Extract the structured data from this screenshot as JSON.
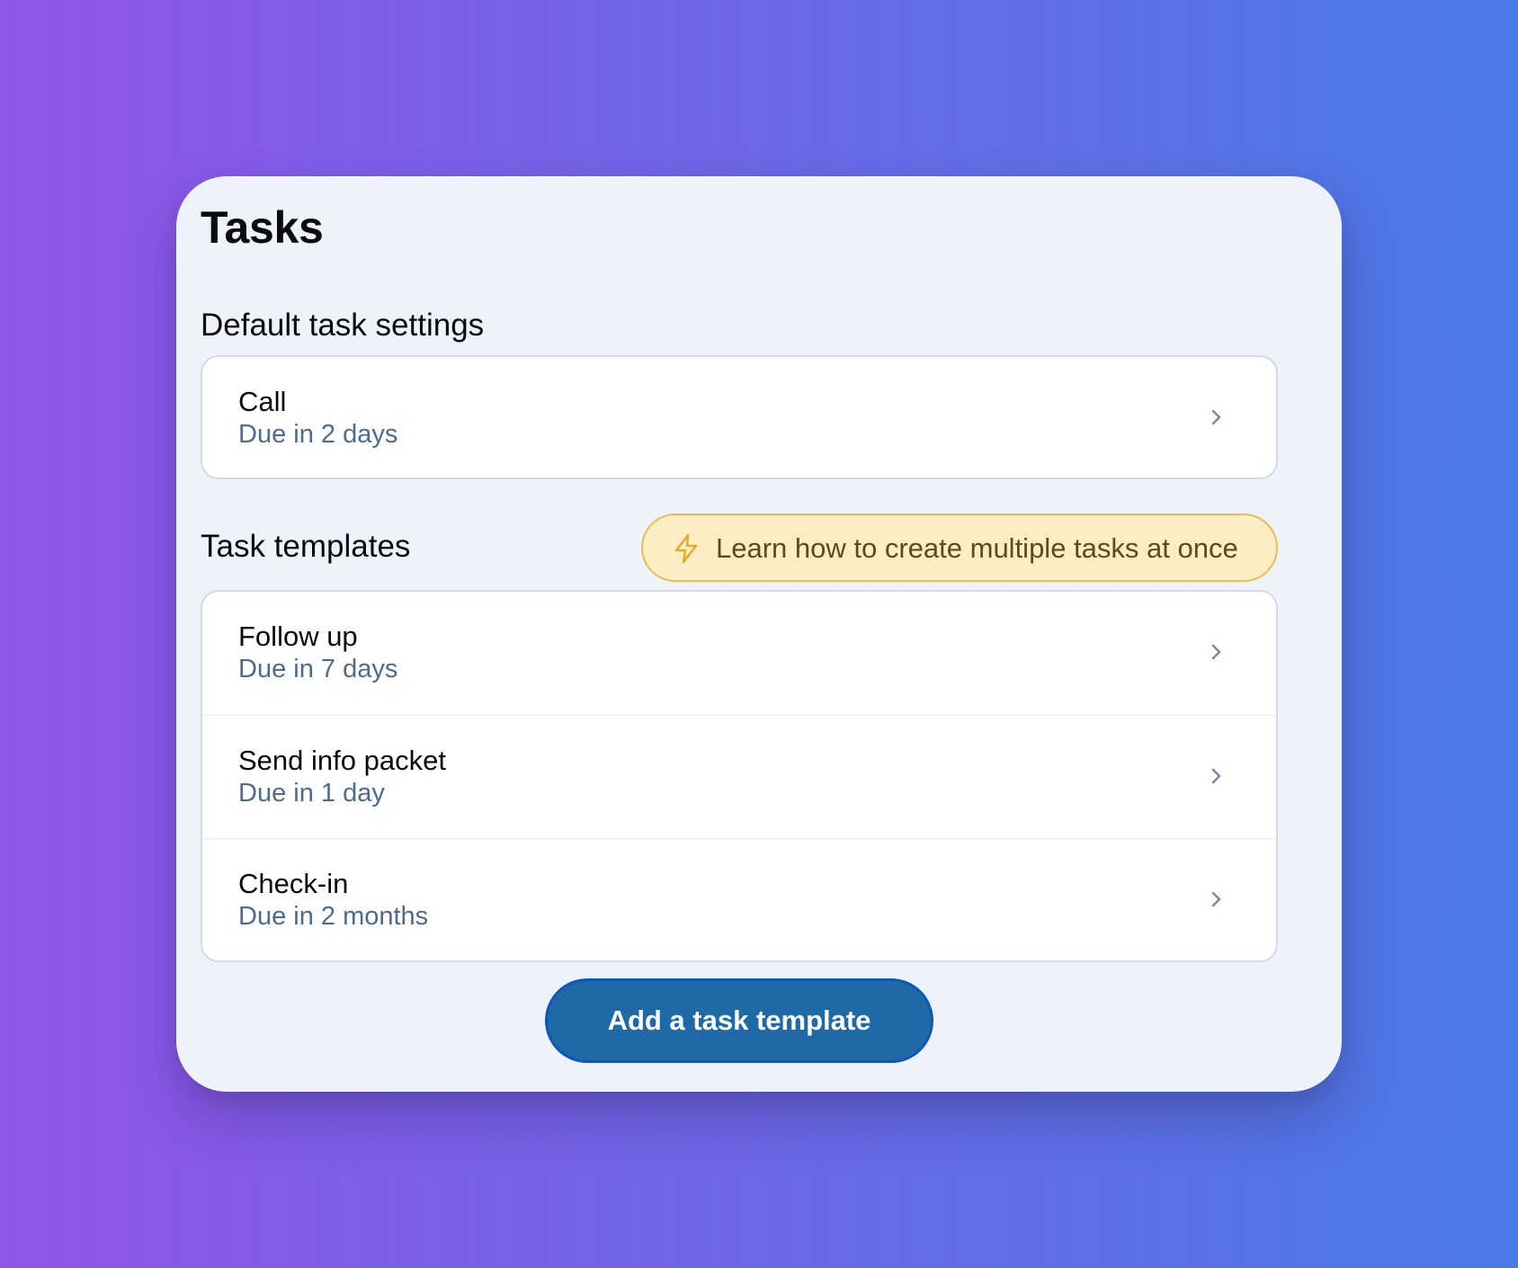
{
  "page": {
    "title": "Tasks"
  },
  "default_settings": {
    "heading": "Default task settings",
    "items": [
      {
        "title": "Call",
        "due": "Due in 2 days"
      }
    ]
  },
  "templates": {
    "heading": "Task templates",
    "learn_link": {
      "label": "Learn how to create multiple tasks at once",
      "icon": "lightning-bolt-icon"
    },
    "items": [
      {
        "title": "Follow up",
        "due": "Due in 7 days"
      },
      {
        "title": "Send info packet",
        "due": "Due in 1 day"
      },
      {
        "title": "Check-in",
        "due": "Due in 2 months"
      }
    ],
    "add_button_label": "Add a task template"
  },
  "colors": {
    "background_gradient_start": "#9155e8",
    "background_gradient_end": "#4a7ae5",
    "card_background": "#eef3fb",
    "primary_button": "#1f6aa6",
    "subtext": "#4d6b8c",
    "tip_background": "#fbeec4",
    "tip_border": "#e9bd52"
  }
}
